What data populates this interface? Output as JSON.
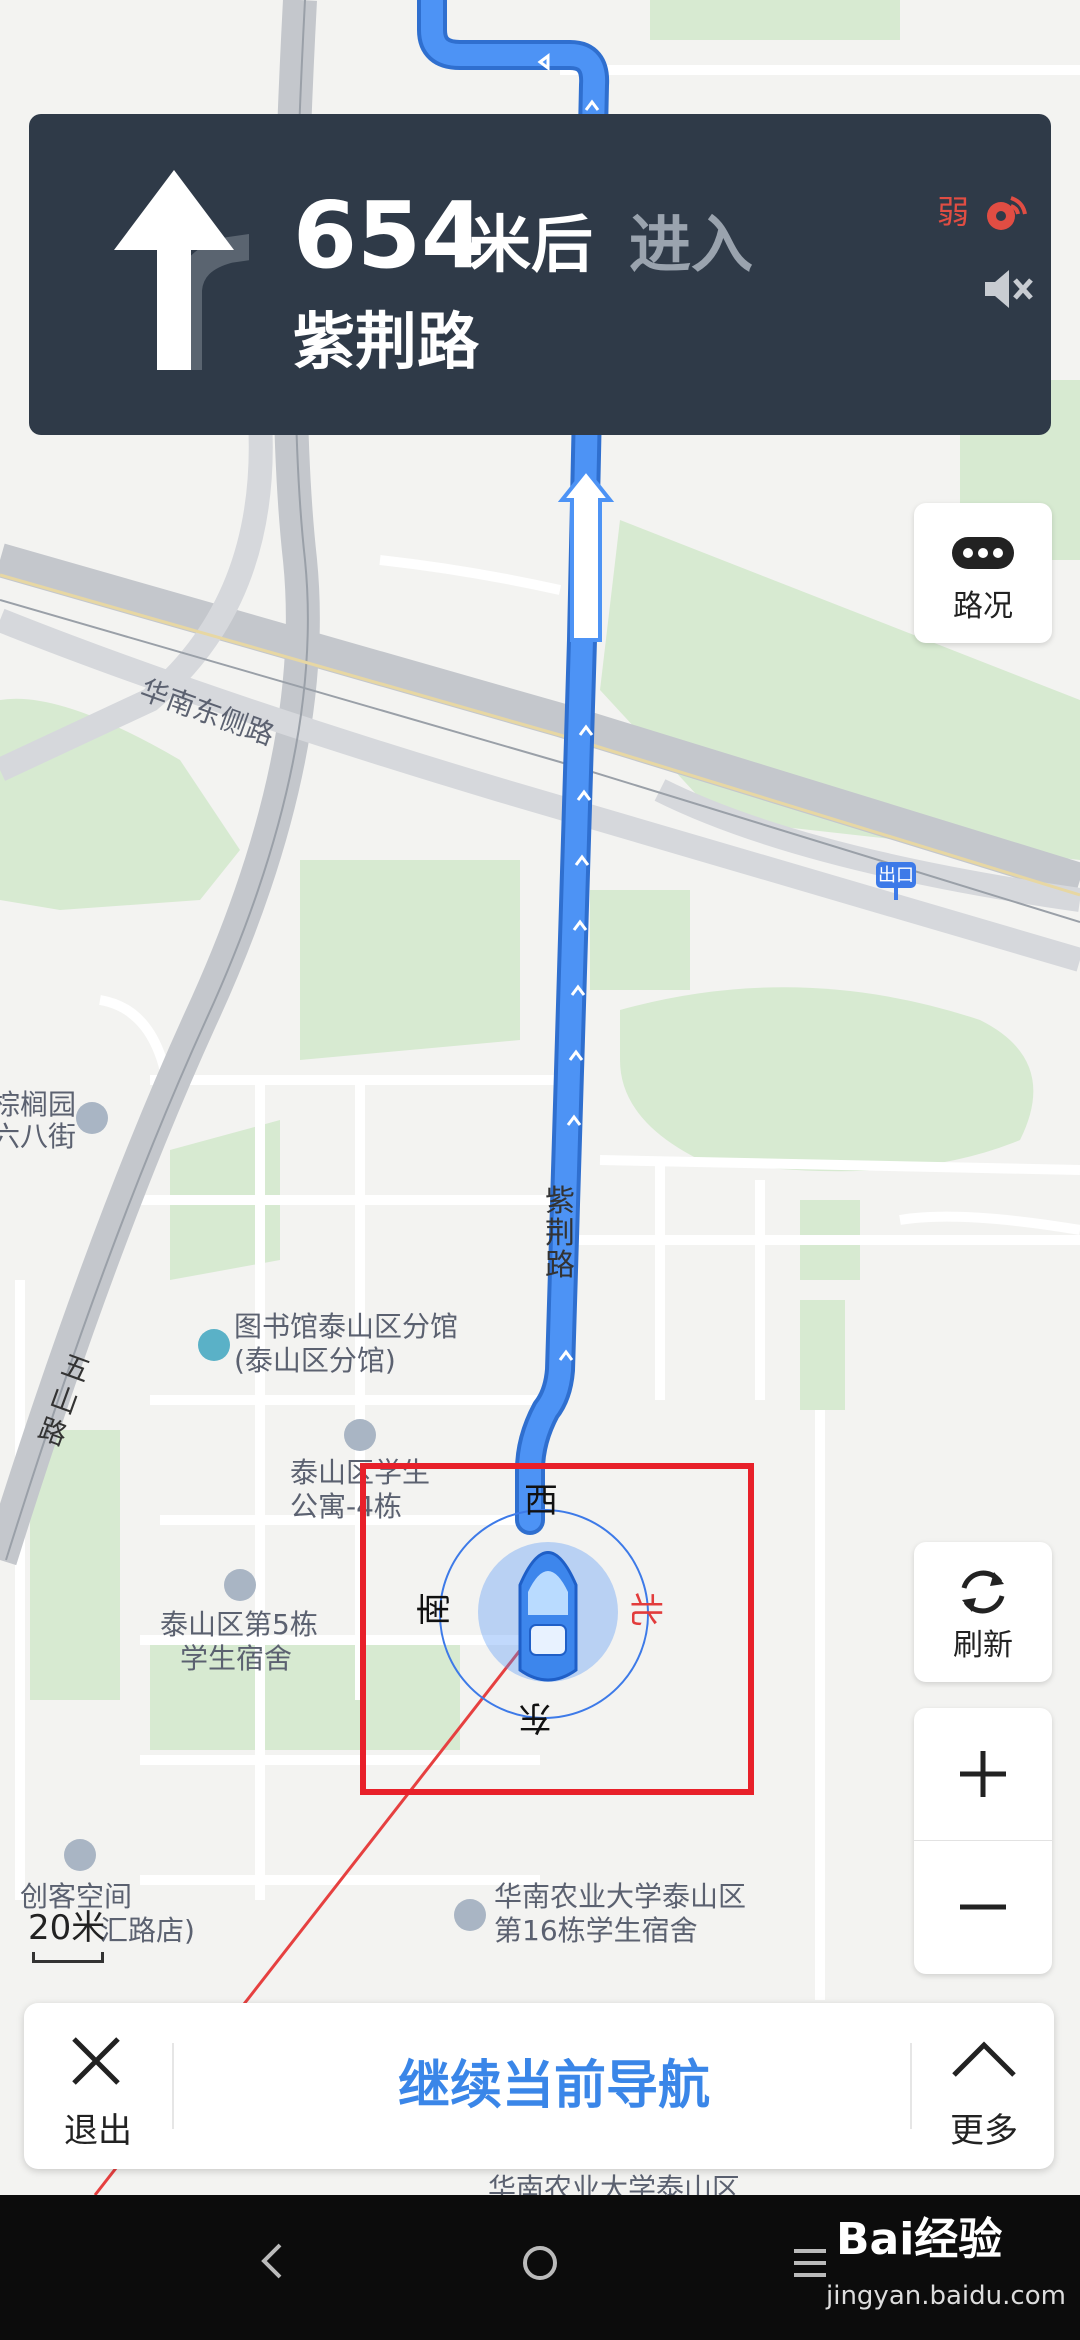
{
  "navigation": {
    "distance": "654",
    "unit": "米后",
    "action": "进入",
    "road": "紫荆路",
    "gps_signal": "弱",
    "icons": {
      "turn_arrow": "straight-arrow-icon",
      "gps": "gps-signal-icon",
      "mute": "mute-icon"
    }
  },
  "controls": {
    "traffic": "路况",
    "refresh": "刷新",
    "zoom_in_icon": "plus-icon",
    "zoom_out_icon": "minus-icon"
  },
  "map": {
    "labels": {
      "road_huanan_east": "华南东侧路",
      "exit": "出口",
      "road_zijing": "紫荆路",
      "road_wushan": "五山路",
      "poi_zonglv_1": "棕榈园",
      "poi_zonglv_2": "六八街",
      "poi_library_1": "图书馆泰山区分馆",
      "poi_library_2": "(泰山区分馆)",
      "poi_dorm4_1": "泰山区学生",
      "poi_dorm4_2": "公寓-4栋",
      "poi_dorm5_1": "泰山区第5栋",
      "poi_dorm5_2": "学生宿舍",
      "poi_maker_1": "创客空间",
      "poi_maker_2": "汇路店)",
      "poi_dorm16_1": "华南农业大学泰山区",
      "poi_dorm16_2": "第16栋学生宿舍",
      "poi_bottom": "华南农业大学泰山区"
    },
    "compass": {
      "north": "北",
      "south": "南",
      "east": "东",
      "west": "西"
    },
    "scale": "20米",
    "route_color": "#3b86f0"
  },
  "bottom_bar": {
    "exit": "退出",
    "continue": "继续当前导航",
    "more": "更多"
  },
  "watermark": {
    "text": "Bai经验",
    "url": "jingyan.baidu.com"
  }
}
